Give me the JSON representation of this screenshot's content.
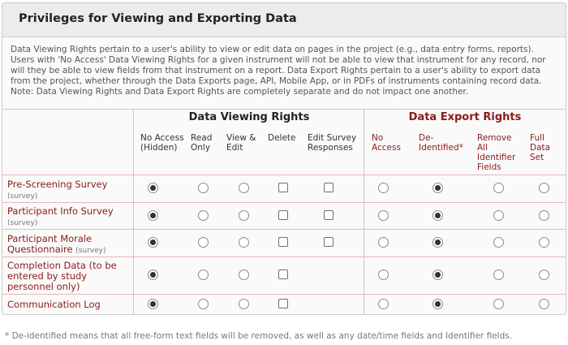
{
  "panel": {
    "title": "Privileges for Viewing and Exporting Data",
    "intro": "Data Viewing Rights pertain to a user's ability to view or edit data on pages in the project (e.g., data entry forms, reports). Users with 'No Access' Data Viewing Rights for a given instrument will not be able to view that instrument for any record, nor will they be able to view fields from that instrument on a report. Data Export Rights pertain to a user's ability to export data from the project, whether through the Data Exports page, API, Mobile App, or in PDFs of instruments containing record data. Note: Data Viewing Rights and Data Export Rights are completely separate and do not impact one another."
  },
  "groups": {
    "viewing": "Data Viewing Rights",
    "export": "Data Export Rights"
  },
  "columns": {
    "viewing": [
      "No Access (Hidden)",
      "Read Only",
      "View & Edit",
      "Delete",
      "Edit Survey Responses"
    ],
    "export": [
      "No Access",
      "De-Identified*",
      "Remove All Identifier Fields",
      "Full Data Set"
    ]
  },
  "rows": [
    {
      "label": "Pre-Screening Survey",
      "sub": "(survey)",
      "view": "No Access (Hidden)",
      "delete": false,
      "edit_survey": false,
      "export": "De-Identified*"
    },
    {
      "label": "Participant Info Survey",
      "sub": "(survey)",
      "view": "No Access (Hidden)",
      "delete": false,
      "edit_survey": false,
      "export": "De-Identified*"
    },
    {
      "label": "Participant Morale Questionnaire",
      "sub": "(survey)",
      "view": "No Access (Hidden)",
      "delete": false,
      "edit_survey": false,
      "export": "De-Identified*"
    },
    {
      "label": "Completion Data (to be entered by study personnel only)",
      "sub": "",
      "view": "No Access (Hidden)",
      "delete": false,
      "edit_survey": null,
      "export": "De-Identified*"
    },
    {
      "label": "Communication Log",
      "sub": "",
      "view": "No Access (Hidden)",
      "delete": false,
      "edit_survey": null,
      "export": "De-Identified*"
    }
  ],
  "footnote": "* De-identified means that all free-form text fields will be removed, as well as any date/time fields and Identifier fields."
}
